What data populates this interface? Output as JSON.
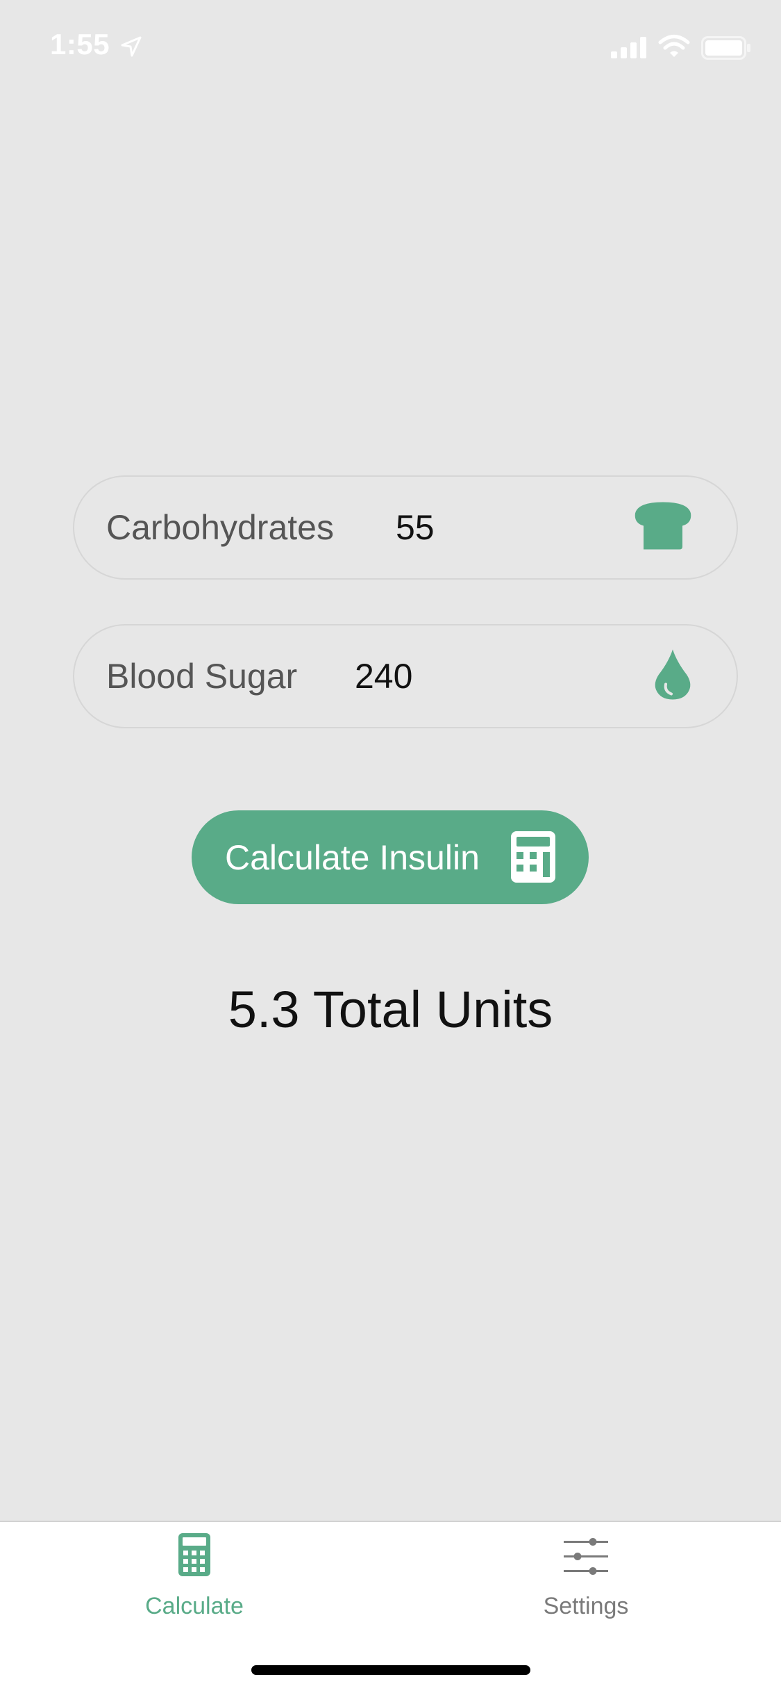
{
  "status_bar": {
    "time": "1:55"
  },
  "carbohydrates": {
    "label": "Carbohydrates",
    "value": "55",
    "icon": "bread-icon"
  },
  "blood_sugar": {
    "label": "Blood Sugar",
    "value": "240",
    "icon": "blood-drop-icon"
  },
  "calculate_button": {
    "label": "Calculate Insulin",
    "icon": "calculator-icon"
  },
  "result": {
    "text": "5.3 Total Units"
  },
  "tab_bar": {
    "tabs": [
      {
        "label": "Calculate",
        "icon": "calculator-icon",
        "selected": true
      },
      {
        "label": "Settings",
        "icon": "sliders-icon",
        "selected": false
      }
    ]
  },
  "colors": {
    "accent": "#59ab88",
    "background": "#e7e7e7",
    "inactive": "#7a7a7a"
  }
}
